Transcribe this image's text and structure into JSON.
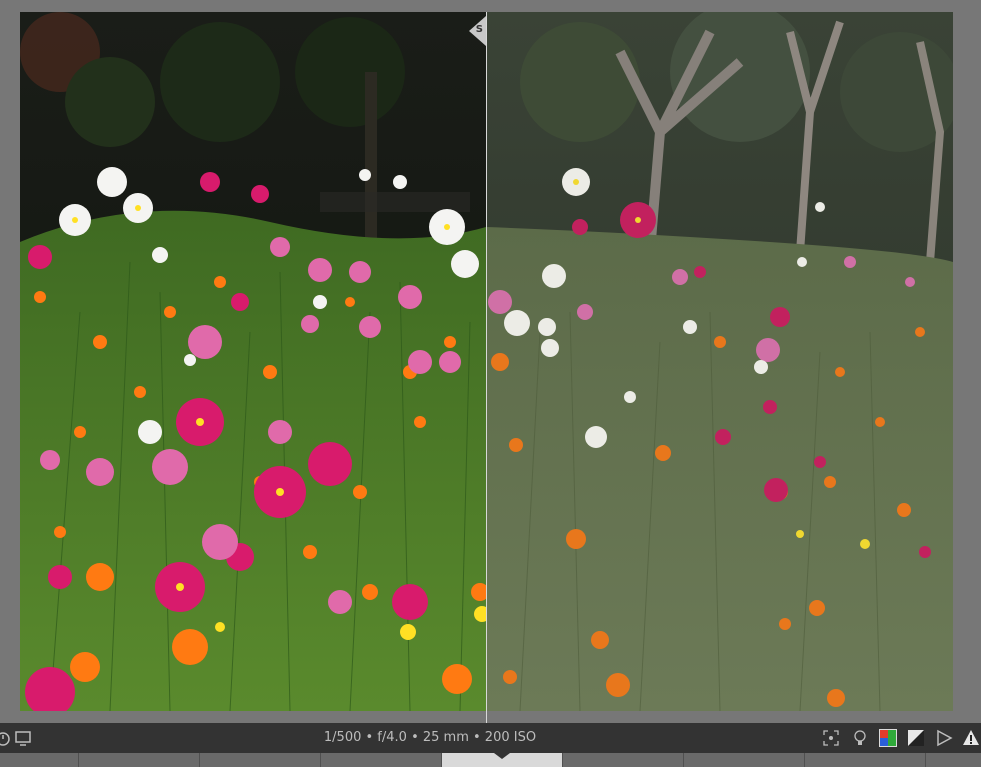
{
  "viewer": {
    "split_handle_label": "S",
    "mode": "before-after-split",
    "photo_subject": "field of cosmos flowers"
  },
  "infobar": {
    "exif": "1/500 • f/4.0 • 25 mm • 200 ISO",
    "icons": [
      "timer-icon",
      "monitor-icon",
      "focus-point-icon",
      "lightbulb-icon",
      "color-palette-icon",
      "tone-curve-icon",
      "play-icon",
      "warning-icon"
    ]
  },
  "colors": {
    "background": "#777777",
    "infobar": "#333333",
    "active_thumb": "#d9d9d9",
    "palette_red": "#e23c2c",
    "palette_green": "#2faa3a",
    "palette_blue": "#2a5fd8"
  }
}
